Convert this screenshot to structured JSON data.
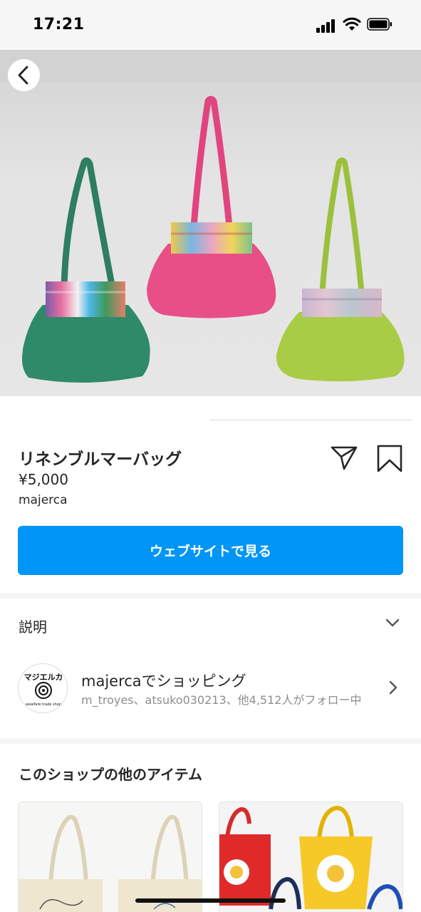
{
  "status_bar": {
    "time": "17:21"
  },
  "product": {
    "title": "リネンブルマーバッグ",
    "price": "¥5,000",
    "seller": "majerca",
    "cta_label": "ウェブサイトで見る",
    "image_progress": 0.5
  },
  "description": {
    "label": "説明"
  },
  "shop": {
    "name": "majercaでショッピング",
    "followers": "m_troyes、atsuko030213、他4,512人がフォロー中",
    "logo_text": "マジエルカ",
    "logo_tagline": "wealfare trade shop"
  },
  "more_items": {
    "title": "このショップの他のアイテム"
  },
  "icons": {
    "back": "chevron-left-icon",
    "share": "paper-plane-icon",
    "save": "bookmark-icon",
    "expand": "chevron-down-icon",
    "open_shop": "chevron-right-icon"
  },
  "colors": {
    "accent": "#0095f6",
    "bag_green": "#2e8a68",
    "bag_pink": "#e94f87",
    "bag_lime": "#a8cc45"
  }
}
